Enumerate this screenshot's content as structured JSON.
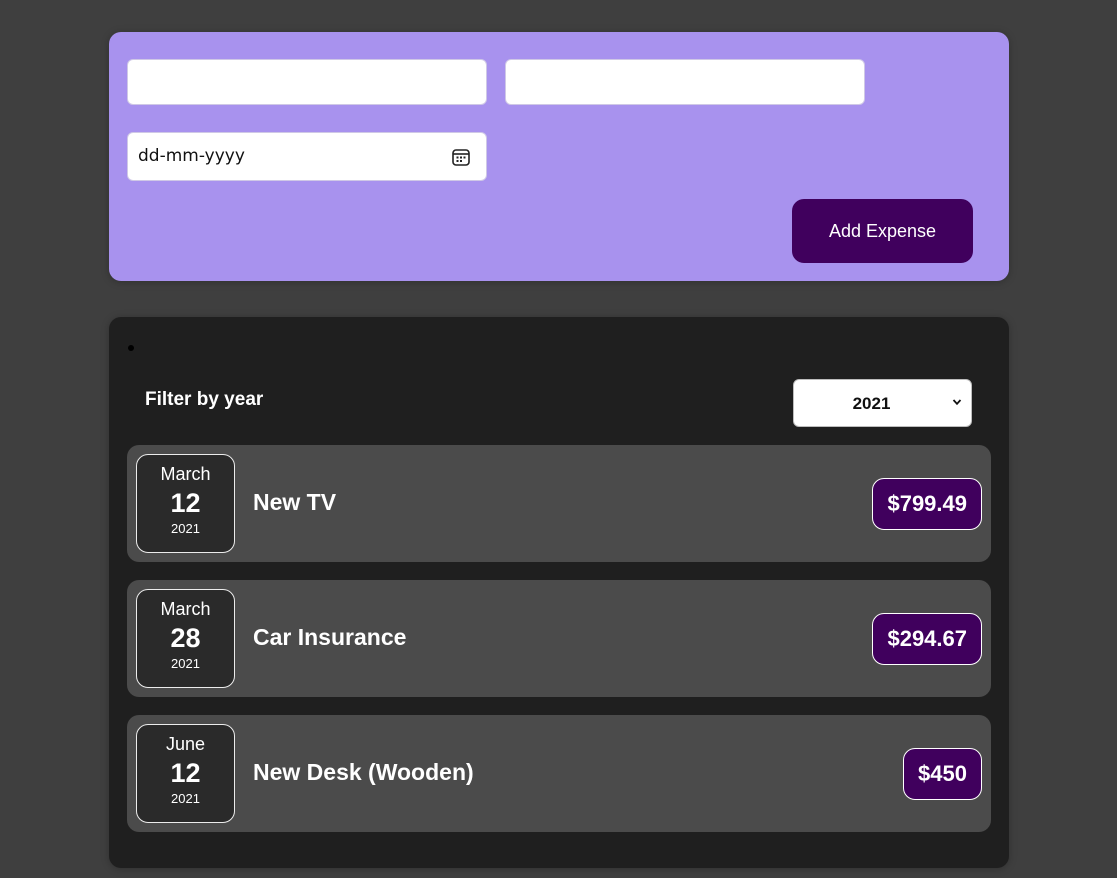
{
  "form": {
    "title_value": "",
    "amount_value": "",
    "date_placeholder": "dd-mm-yyyy",
    "add_button_label": "Add Expense"
  },
  "filter": {
    "label": "Filter by year",
    "selected_year": "2021"
  },
  "expenses": [
    {
      "month": "March",
      "day": "12",
      "year": "2021",
      "title": "New TV",
      "amount": "$799.49"
    },
    {
      "month": "March",
      "day": "28",
      "year": "2021",
      "title": "Car Insurance",
      "amount": "$294.67"
    },
    {
      "month": "June",
      "day": "12",
      "year": "2021",
      "title": "New Desk (Wooden)",
      "amount": "$450"
    }
  ],
  "icons": {
    "date_picker": "calendar-icon",
    "select_arrow": "chevron-down-icon"
  },
  "colors": {
    "page_background": "#3f3f3f",
    "form_background": "#a892ee",
    "button_background": "#40005d",
    "list_background": "#1f1f1f",
    "item_background": "#4b4b4b",
    "date_box_background": "#2a2a2a"
  }
}
